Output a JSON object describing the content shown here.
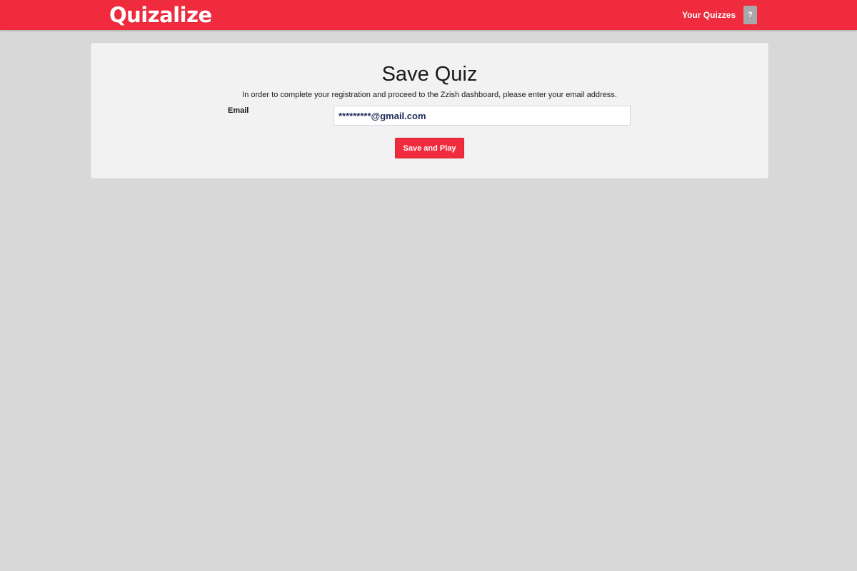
{
  "header": {
    "logo_text": "Quizalize",
    "nav_link": "Your Quizzes",
    "help_label": "?"
  },
  "main": {
    "title": "Save Quiz",
    "instructions": "In order to complete your registration and proceed to the Zzish dashboard, please enter your email address.",
    "email_label": "Email",
    "email_value": "*********@gmail.com",
    "submit_label": "Save and Play"
  },
  "colors": {
    "brand": "#ef2b3d",
    "background": "#d8d8d8",
    "panel": "#f2f2f2"
  }
}
